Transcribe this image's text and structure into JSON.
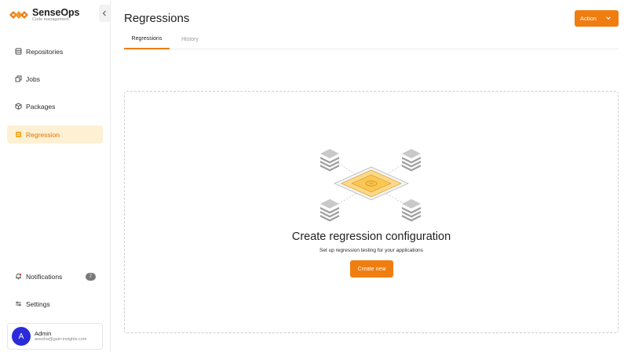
{
  "brand": {
    "name": "SenseOps",
    "subtitle": "Code management",
    "color": "#f07d10"
  },
  "sidebar": {
    "items": [
      {
        "label": "Repositories",
        "icon": "database-icon"
      },
      {
        "label": "Jobs",
        "icon": "jobs-icon"
      },
      {
        "label": "Packages",
        "icon": "package-icon"
      },
      {
        "label": "Regression",
        "icon": "regression-icon",
        "active": true
      }
    ],
    "bottom": [
      {
        "label": "Notifications",
        "icon": "bell-icon",
        "badge": "7"
      },
      {
        "label": "Settings",
        "icon": "sliders-icon"
      }
    ],
    "user": {
      "initial": "A",
      "name": "Admin",
      "email": "anesha@gain-insights.com"
    }
  },
  "header": {
    "title": "Regressions",
    "action_label": "Action"
  },
  "tabs": [
    {
      "label": "Regressions",
      "active": true
    },
    {
      "label": "History",
      "active": false
    }
  ],
  "empty_state": {
    "title": "Create regression configuration",
    "subtitle": "Set up regression testing for your applications",
    "button_label": "Create new",
    "illustration": "regression-network-illustration"
  },
  "colors": {
    "accent": "#f07d10",
    "active_bg": "#fdf0d3",
    "avatar": "#2b2bd9"
  }
}
